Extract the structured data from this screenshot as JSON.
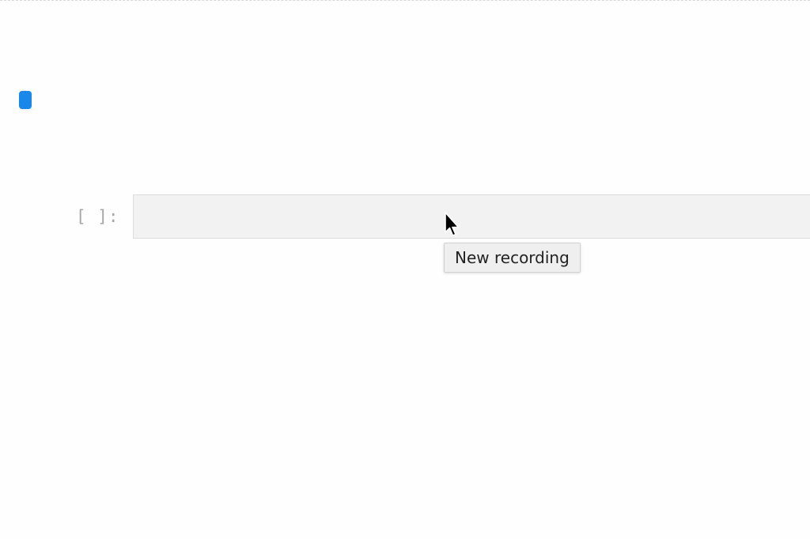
{
  "notebook": {
    "cell": {
      "prompt": "[ ]:",
      "input_value": ""
    },
    "tooltip": {
      "text": "New recording"
    }
  },
  "colors": {
    "active_cell_indicator": "#1a88ea",
    "cell_background": "#f2f2f2",
    "prompt_text": "#a6a6a6"
  },
  "icons": {
    "cursor": "arrow-cursor-icon"
  }
}
